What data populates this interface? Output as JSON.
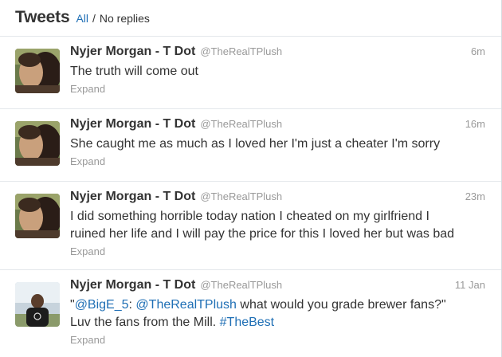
{
  "header": {
    "title": "Tweets",
    "filter_all": "All",
    "separator": "/",
    "filter_noreplies": "No replies"
  },
  "tweets": [
    {
      "name": "Nyjer Morgan - T Dot",
      "handle": "@TheRealTPlush",
      "time": "6m",
      "text_lines": [
        "The truth will come out"
      ],
      "expand": "Expand"
    },
    {
      "name": "Nyjer Morgan - T Dot",
      "handle": "@TheRealTPlush",
      "time": "16m",
      "text_lines": [
        "She caught me as much as I loved her I'm just a cheater I'm sorry"
      ],
      "expand": "Expand"
    },
    {
      "name": "Nyjer Morgan - T Dot",
      "handle": "@TheRealTPlush",
      "time": "23m",
      "text_lines": [
        "I did something horrible today nation I cheated on my girlfriend I",
        "ruined her life and I will pay the price for this I loved her but was bad"
      ],
      "expand": "Expand"
    },
    {
      "name": "Nyjer Morgan - T Dot",
      "handle": "@TheRealTPlush",
      "time": "11 Jan",
      "quote_open": "\"",
      "mention1": "@BigE_5",
      "colon": ": ",
      "mention2": "@TheRealTPlush",
      "text_after_mention": " what would you grade brewer fans?\"",
      "line2_text": "Luv the fans from the Mill. ",
      "hashtag": "#TheBest",
      "expand": "Expand"
    }
  ],
  "colors": {
    "link": "#1f6fb5",
    "text": "#333333",
    "muted": "#999999",
    "divider": "#e4e8eb"
  },
  "icons": {
    "avatar": "profile-photo"
  }
}
